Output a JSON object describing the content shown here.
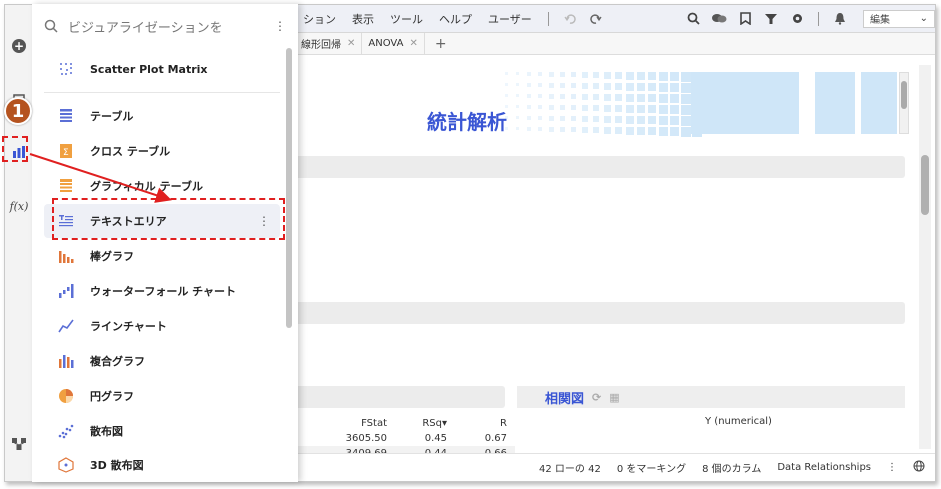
{
  "menubar": {
    "items": [
      "ション",
      "表示",
      "ツール",
      "ヘルプ",
      "ユーザー"
    ],
    "edit_select": "編集"
  },
  "tabs": [
    {
      "label": "線形回帰"
    },
    {
      "label": "ANOVA"
    }
  ],
  "canvas": {
    "title": "統計解析",
    "section_title": "相関図",
    "y_label": "Y (numerical)",
    "table": {
      "headers": [
        "FStat",
        "RSq",
        "R"
      ],
      "rows": [
        [
          "3605.50",
          "0.45",
          "0.67"
        ],
        [
          "3409.69",
          "0.44",
          "0.66"
        ]
      ]
    }
  },
  "status": {
    "rows": "42 ローの 42",
    "marking": "0 をマーキング",
    "columns": "8 個のカラム",
    "relationships": "Data Relationships"
  },
  "panel": {
    "search_placeholder": "ビジュアライゼーションを",
    "items": [
      {
        "label": "Scatter Plot Matrix",
        "icon": "scatter-matrix-icon"
      },
      {
        "label": "テーブル",
        "icon": "table-icon"
      },
      {
        "label": "クロス テーブル",
        "icon": "cross-table-icon"
      },
      {
        "label": "グラフィカル テーブル",
        "icon": "graphical-table-icon"
      },
      {
        "label": "テキストエリア",
        "icon": "text-area-icon"
      },
      {
        "label": "棒グラフ",
        "icon": "bar-chart-icon"
      },
      {
        "label": "ウォーターフォール チャート",
        "icon": "waterfall-chart-icon"
      },
      {
        "label": "ラインチャート",
        "icon": "line-chart-icon"
      },
      {
        "label": "複合グラフ",
        "icon": "combination-chart-icon"
      },
      {
        "label": "円グラフ",
        "icon": "pie-chart-icon"
      },
      {
        "label": "散布図",
        "icon": "scatter-plot-icon"
      },
      {
        "label": "3D 散布図",
        "icon": "3d-scatter-icon"
      }
    ]
  },
  "callout": {
    "number": "1"
  },
  "colors": {
    "accent": "#3a56d4",
    "annotation": "#e02020",
    "callout": "#b5531f"
  }
}
